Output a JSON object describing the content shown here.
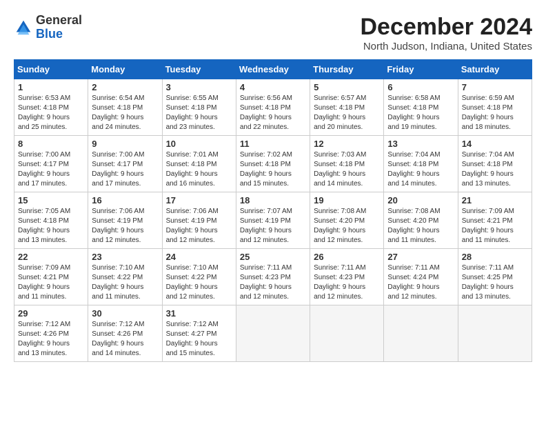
{
  "logo": {
    "general": "General",
    "blue": "Blue"
  },
  "header": {
    "month": "December 2024",
    "location": "North Judson, Indiana, United States"
  },
  "days_of_week": [
    "Sunday",
    "Monday",
    "Tuesday",
    "Wednesday",
    "Thursday",
    "Friday",
    "Saturday"
  ],
  "weeks": [
    [
      {
        "day": "1",
        "info": "Sunrise: 6:53 AM\nSunset: 4:18 PM\nDaylight: 9 hours\nand 25 minutes."
      },
      {
        "day": "2",
        "info": "Sunrise: 6:54 AM\nSunset: 4:18 PM\nDaylight: 9 hours\nand 24 minutes."
      },
      {
        "day": "3",
        "info": "Sunrise: 6:55 AM\nSunset: 4:18 PM\nDaylight: 9 hours\nand 23 minutes."
      },
      {
        "day": "4",
        "info": "Sunrise: 6:56 AM\nSunset: 4:18 PM\nDaylight: 9 hours\nand 22 minutes."
      },
      {
        "day": "5",
        "info": "Sunrise: 6:57 AM\nSunset: 4:18 PM\nDaylight: 9 hours\nand 20 minutes."
      },
      {
        "day": "6",
        "info": "Sunrise: 6:58 AM\nSunset: 4:18 PM\nDaylight: 9 hours\nand 19 minutes."
      },
      {
        "day": "7",
        "info": "Sunrise: 6:59 AM\nSunset: 4:18 PM\nDaylight: 9 hours\nand 18 minutes."
      }
    ],
    [
      {
        "day": "8",
        "info": "Sunrise: 7:00 AM\nSunset: 4:17 PM\nDaylight: 9 hours\nand 17 minutes."
      },
      {
        "day": "9",
        "info": "Sunrise: 7:00 AM\nSunset: 4:17 PM\nDaylight: 9 hours\nand 17 minutes."
      },
      {
        "day": "10",
        "info": "Sunrise: 7:01 AM\nSunset: 4:18 PM\nDaylight: 9 hours\nand 16 minutes."
      },
      {
        "day": "11",
        "info": "Sunrise: 7:02 AM\nSunset: 4:18 PM\nDaylight: 9 hours\nand 15 minutes."
      },
      {
        "day": "12",
        "info": "Sunrise: 7:03 AM\nSunset: 4:18 PM\nDaylight: 9 hours\nand 14 minutes."
      },
      {
        "day": "13",
        "info": "Sunrise: 7:04 AM\nSunset: 4:18 PM\nDaylight: 9 hours\nand 14 minutes."
      },
      {
        "day": "14",
        "info": "Sunrise: 7:04 AM\nSunset: 4:18 PM\nDaylight: 9 hours\nand 13 minutes."
      }
    ],
    [
      {
        "day": "15",
        "info": "Sunrise: 7:05 AM\nSunset: 4:18 PM\nDaylight: 9 hours\nand 13 minutes."
      },
      {
        "day": "16",
        "info": "Sunrise: 7:06 AM\nSunset: 4:19 PM\nDaylight: 9 hours\nand 12 minutes."
      },
      {
        "day": "17",
        "info": "Sunrise: 7:06 AM\nSunset: 4:19 PM\nDaylight: 9 hours\nand 12 minutes."
      },
      {
        "day": "18",
        "info": "Sunrise: 7:07 AM\nSunset: 4:19 PM\nDaylight: 9 hours\nand 12 minutes."
      },
      {
        "day": "19",
        "info": "Sunrise: 7:08 AM\nSunset: 4:20 PM\nDaylight: 9 hours\nand 12 minutes."
      },
      {
        "day": "20",
        "info": "Sunrise: 7:08 AM\nSunset: 4:20 PM\nDaylight: 9 hours\nand 11 minutes."
      },
      {
        "day": "21",
        "info": "Sunrise: 7:09 AM\nSunset: 4:21 PM\nDaylight: 9 hours\nand 11 minutes."
      }
    ],
    [
      {
        "day": "22",
        "info": "Sunrise: 7:09 AM\nSunset: 4:21 PM\nDaylight: 9 hours\nand 11 minutes."
      },
      {
        "day": "23",
        "info": "Sunrise: 7:10 AM\nSunset: 4:22 PM\nDaylight: 9 hours\nand 11 minutes."
      },
      {
        "day": "24",
        "info": "Sunrise: 7:10 AM\nSunset: 4:22 PM\nDaylight: 9 hours\nand 12 minutes."
      },
      {
        "day": "25",
        "info": "Sunrise: 7:11 AM\nSunset: 4:23 PM\nDaylight: 9 hours\nand 12 minutes."
      },
      {
        "day": "26",
        "info": "Sunrise: 7:11 AM\nSunset: 4:23 PM\nDaylight: 9 hours\nand 12 minutes."
      },
      {
        "day": "27",
        "info": "Sunrise: 7:11 AM\nSunset: 4:24 PM\nDaylight: 9 hours\nand 12 minutes."
      },
      {
        "day": "28",
        "info": "Sunrise: 7:11 AM\nSunset: 4:25 PM\nDaylight: 9 hours\nand 13 minutes."
      }
    ],
    [
      {
        "day": "29",
        "info": "Sunrise: 7:12 AM\nSunset: 4:26 PM\nDaylight: 9 hours\nand 13 minutes."
      },
      {
        "day": "30",
        "info": "Sunrise: 7:12 AM\nSunset: 4:26 PM\nDaylight: 9 hours\nand 14 minutes."
      },
      {
        "day": "31",
        "info": "Sunrise: 7:12 AM\nSunset: 4:27 PM\nDaylight: 9 hours\nand 15 minutes."
      },
      null,
      null,
      null,
      null
    ]
  ]
}
